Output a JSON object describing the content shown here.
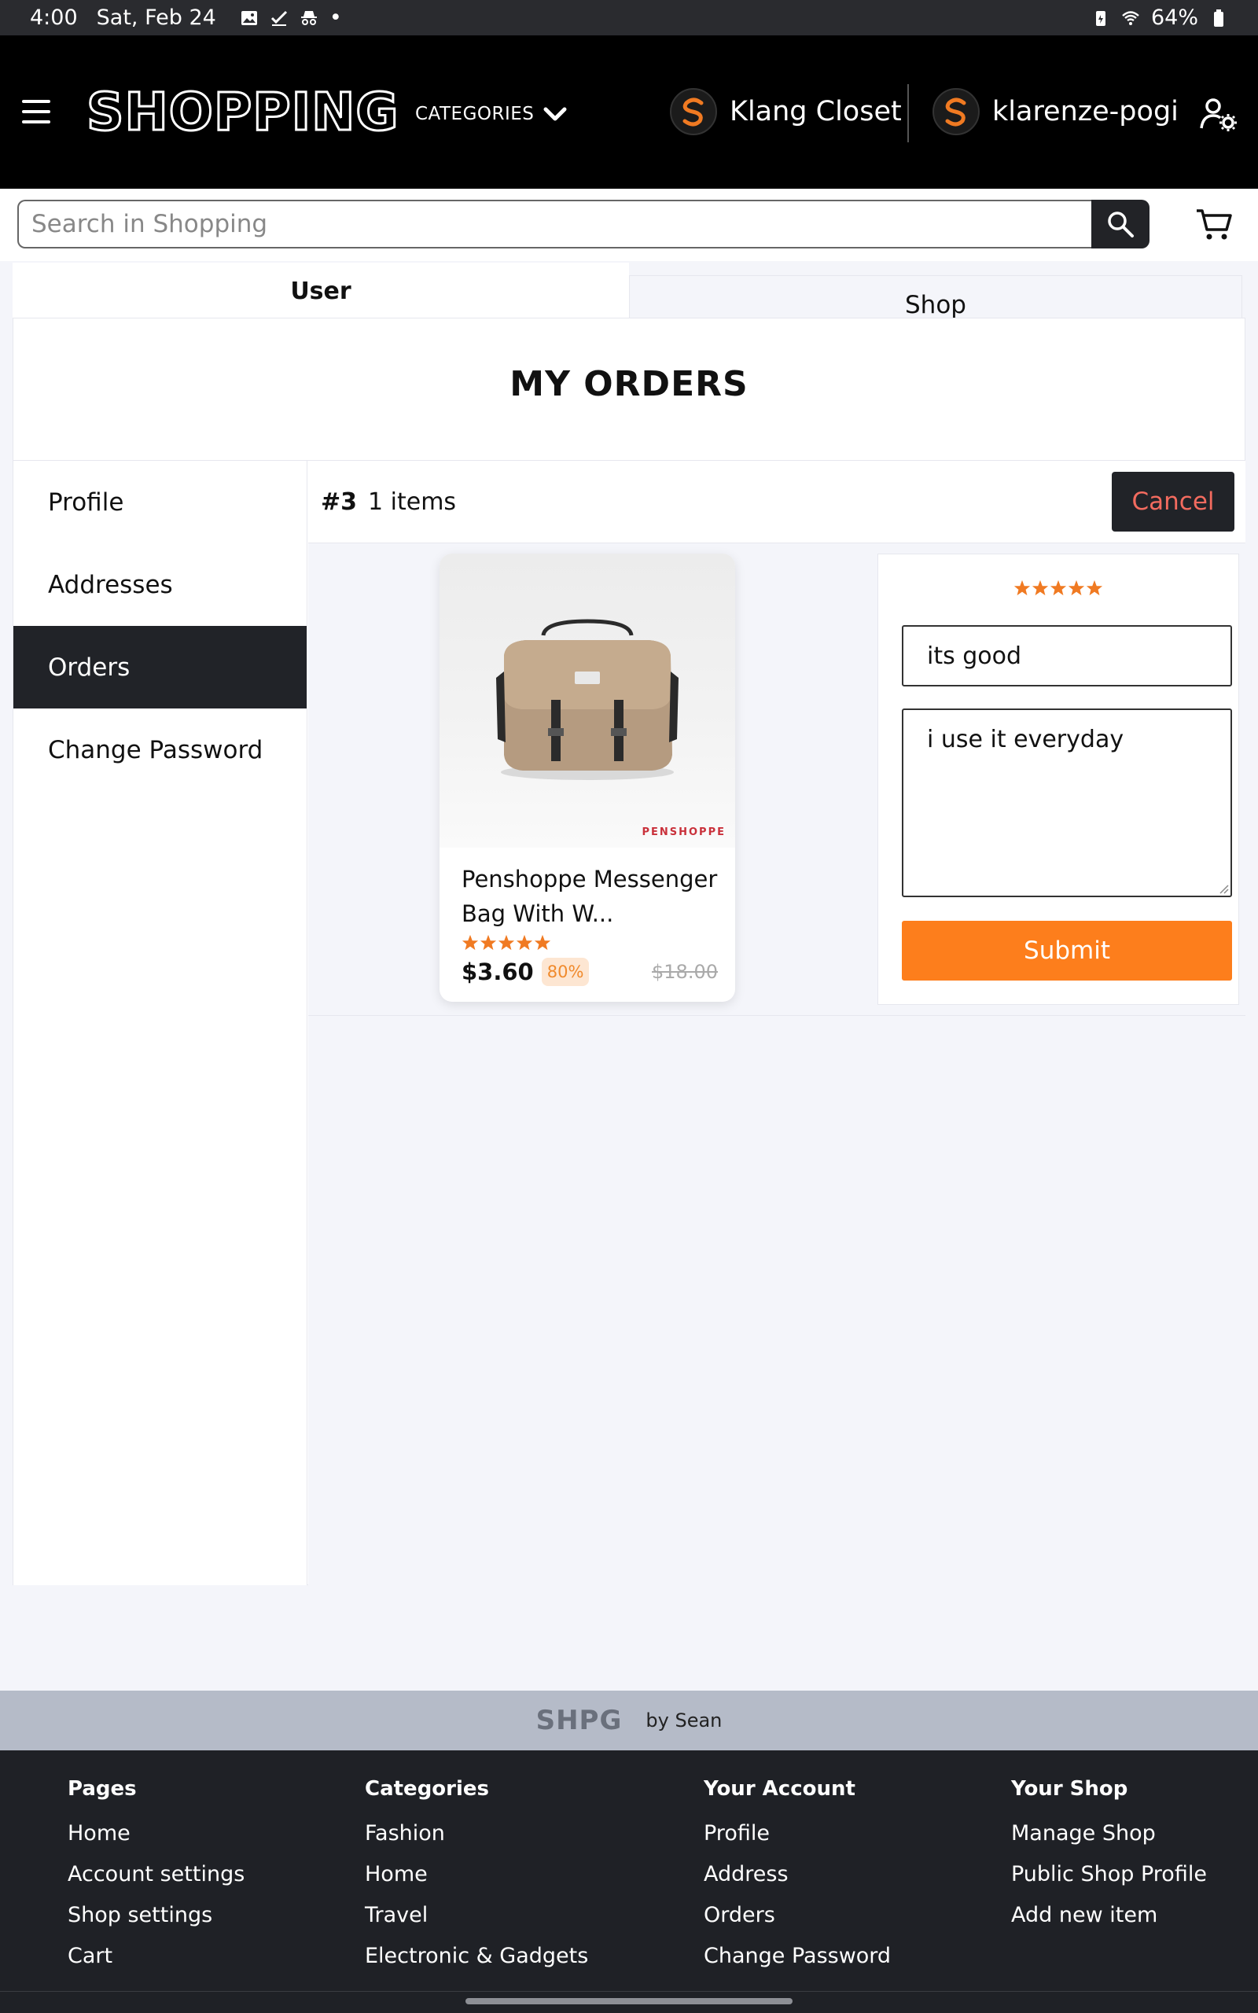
{
  "status_bar": {
    "time": "4:00",
    "date": "Sat, Feb 24",
    "dot": "•",
    "battery": "64%"
  },
  "header": {
    "logo_text": "SHOPPING",
    "categories_label": "CATEGORIES",
    "shop_name": "Klang Closet",
    "username": "klarenze-pogi",
    "accent_color": "#f07a22"
  },
  "search": {
    "placeholder": "Search in Shopping"
  },
  "tabs": [
    {
      "label": "User",
      "active": true
    },
    {
      "label": "Shop",
      "active": false
    }
  ],
  "page_title": "MY ORDERS",
  "sidebar": {
    "items": [
      {
        "label": "Profile",
        "active": false
      },
      {
        "label": "Addresses",
        "active": false
      },
      {
        "label": "Orders",
        "active": true
      },
      {
        "label": "Change Password",
        "active": false
      }
    ]
  },
  "order": {
    "number": "#3",
    "item_count": "1 items",
    "cancel_label": "Cancel",
    "product": {
      "name": "Penshoppe Messenger Bag With W...",
      "brand_tag": "PENSHOPPE",
      "rating": 5,
      "price": "$3.60",
      "discount": "80%",
      "old_price": "$18.00"
    },
    "review": {
      "rating": 5,
      "title_value": "its good",
      "body_value": "i use it everyday",
      "submit_label": "Submit"
    }
  },
  "footer": {
    "logo": "SHPG",
    "by": "by Sean",
    "columns": [
      {
        "title": "Pages",
        "links": [
          "Home",
          "Account settings",
          "Shop settings",
          "Cart"
        ]
      },
      {
        "title": "Categories",
        "links": [
          "Fashion",
          "Home",
          "Travel",
          "Electronic & Gadgets"
        ]
      },
      {
        "title": "Your Account",
        "links": [
          "Profile",
          "Address",
          "Orders",
          "Change Password"
        ]
      },
      {
        "title": "Your Shop",
        "links": [
          "Manage Shop",
          "Public Shop Profile",
          "Add new item"
        ]
      }
    ]
  },
  "colors": {
    "star": "#f07a22",
    "dark": "#212328",
    "submit": "#fd7e1c",
    "cancel_text": "#f36b5f"
  }
}
